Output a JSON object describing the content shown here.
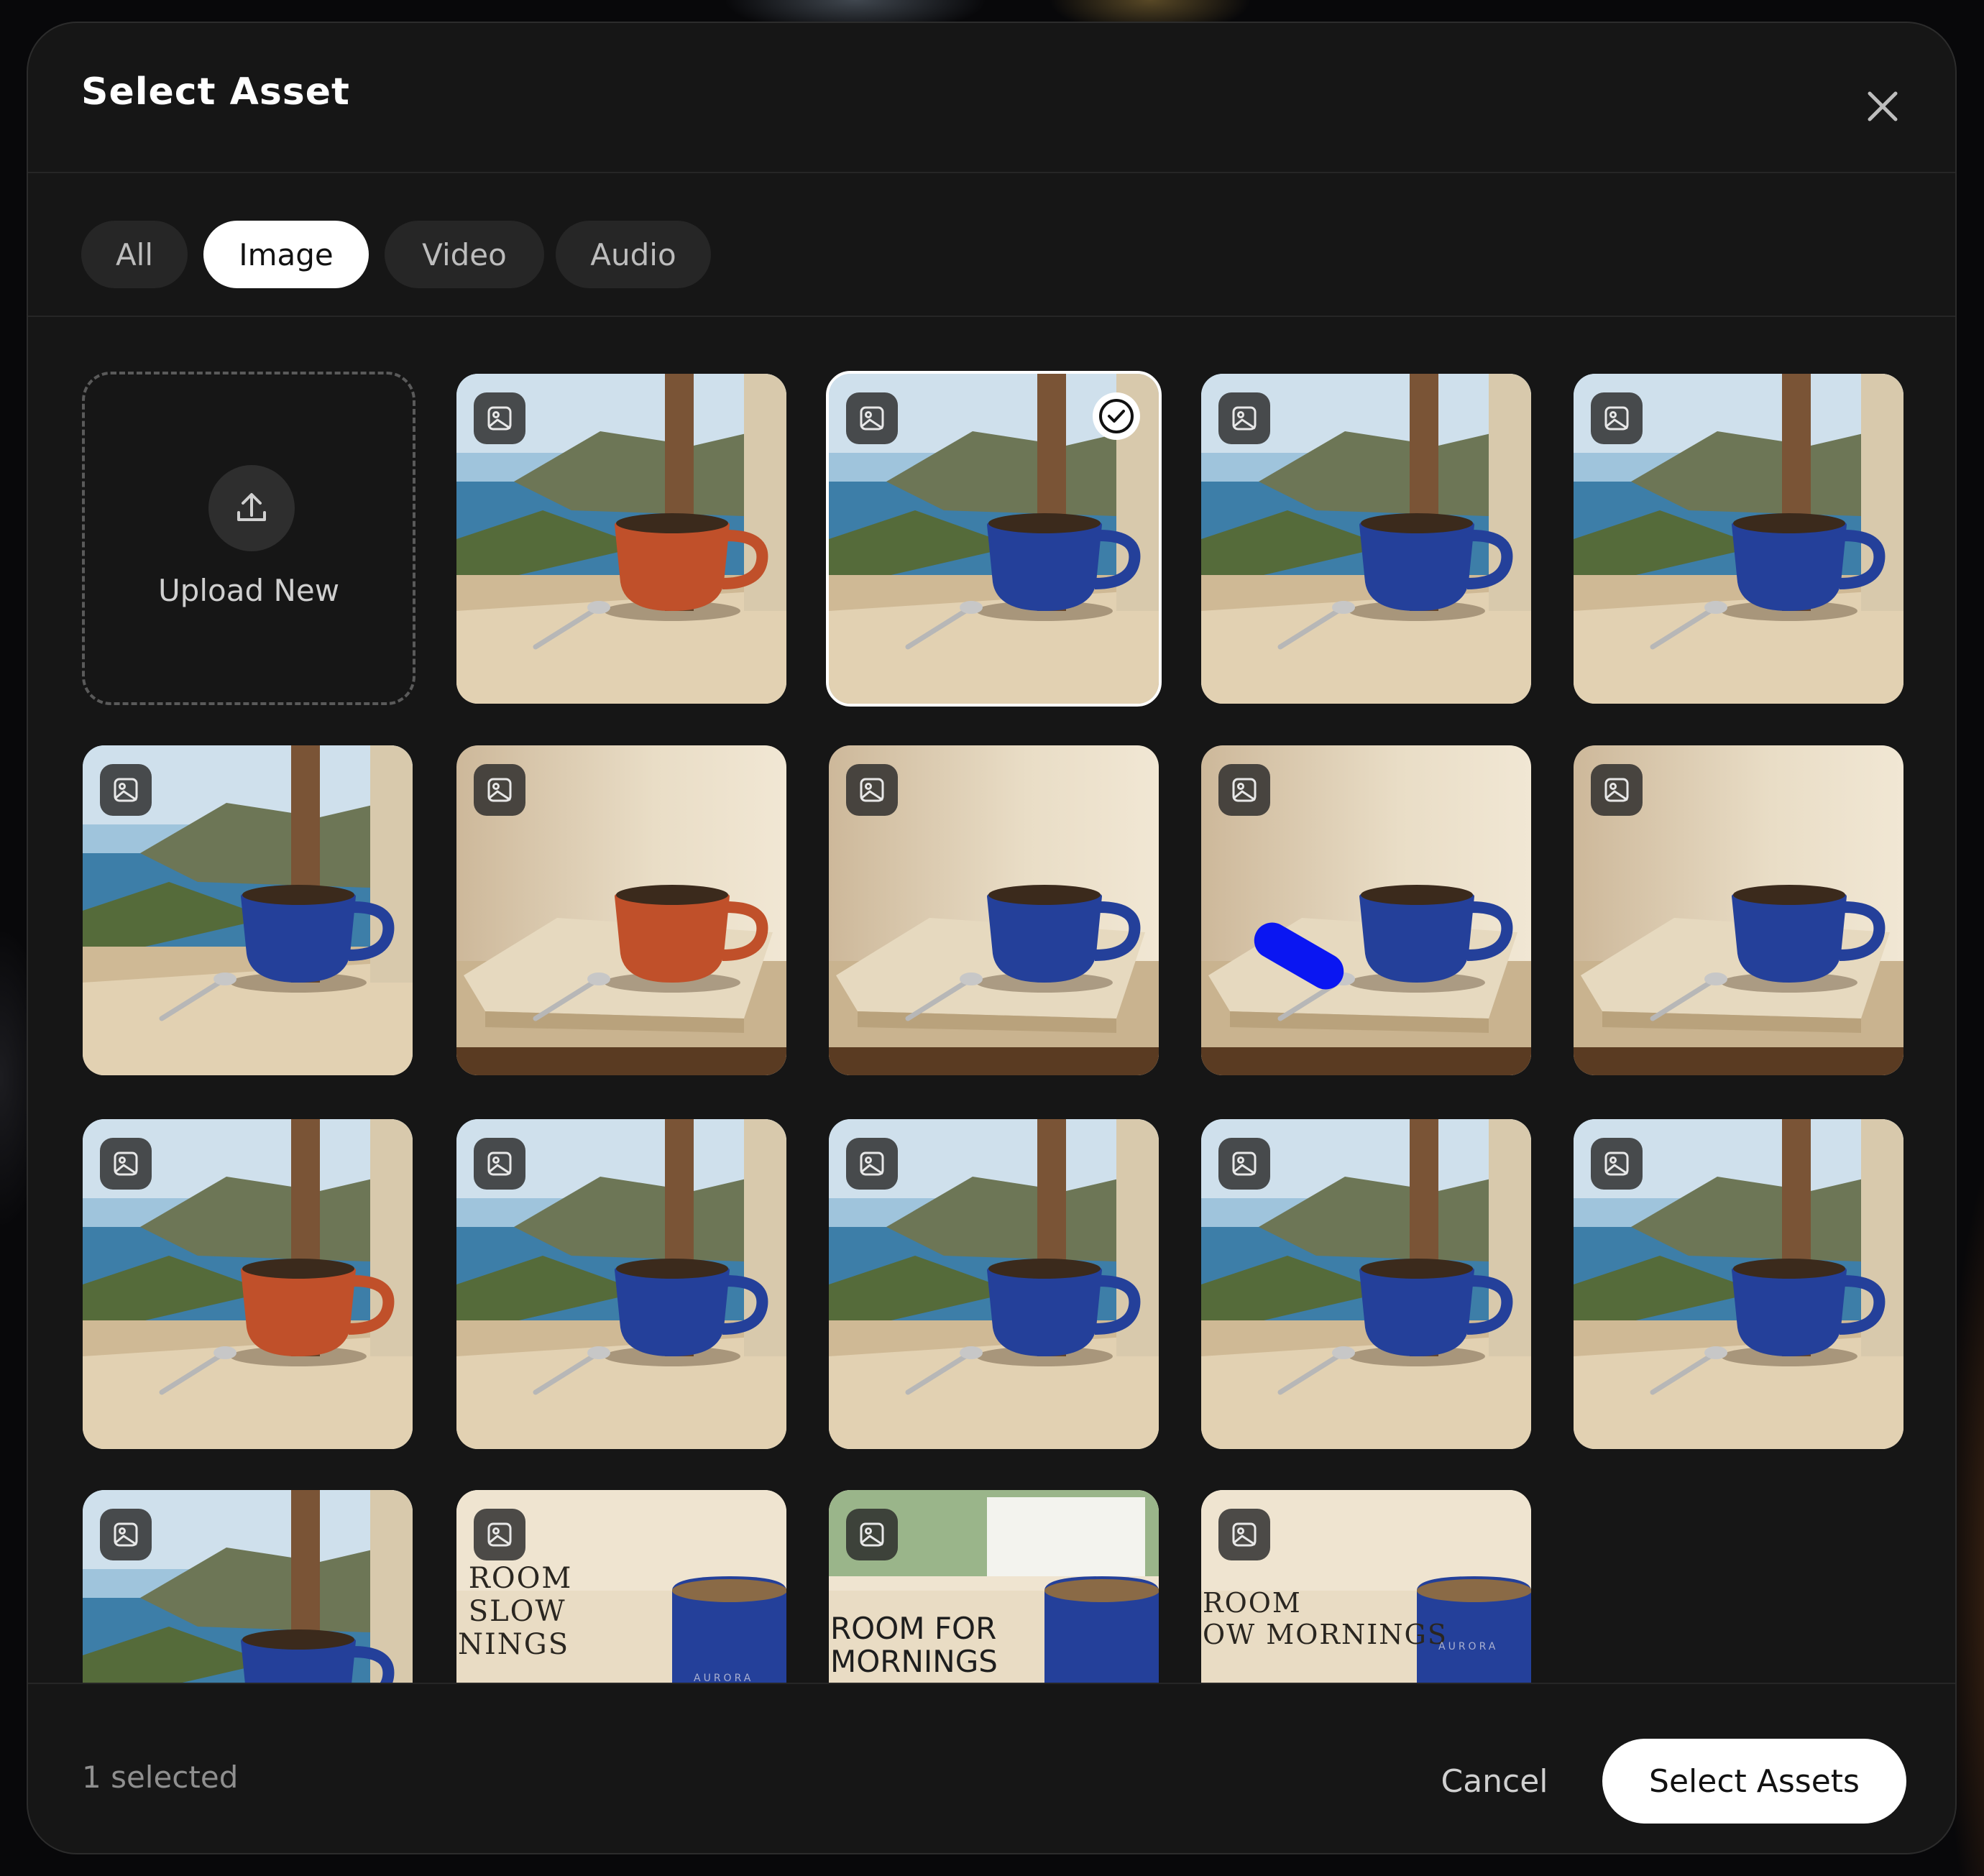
{
  "dialog": {
    "title": "Select Asset",
    "close_icon": "close-icon"
  },
  "tabs": [
    {
      "label": "All",
      "active": false
    },
    {
      "label": "Image",
      "active": true
    },
    {
      "label": "Video",
      "active": false
    },
    {
      "label": "Audio",
      "active": false
    }
  ],
  "upload": {
    "label": "Upload New",
    "icon": "upload-icon"
  },
  "assets": [
    {
      "type_icon": "image-icon",
      "cup": "terracotta",
      "scene": "window-coast-pot",
      "selected": false
    },
    {
      "type_icon": "image-icon",
      "cup": "cobalt-blue",
      "scene": "window-coast-pot",
      "selected": true
    },
    {
      "type_icon": "image-icon",
      "cup": "cobalt-blue",
      "scene": "window-bay-olive",
      "selected": false
    },
    {
      "type_icon": "image-icon",
      "cup": "cobalt-blue",
      "scene": "window-bay-sill",
      "selected": false
    },
    {
      "type_icon": "image-icon",
      "cup": "cobalt-blue",
      "scene": "window-sea-sill",
      "selected": false
    },
    {
      "type_icon": "image-icon",
      "cup": "terracotta",
      "scene": "plaster-wall-stone",
      "selected": false
    },
    {
      "type_icon": "image-icon",
      "cup": "cobalt-blue",
      "scene": "plaster-wall-stone",
      "selected": false
    },
    {
      "type_icon": "image-icon",
      "cup": "cobalt-blue",
      "scene": "plaster-wall-stone-marked",
      "selected": false
    },
    {
      "type_icon": "image-icon",
      "cup": "cobalt-blue",
      "scene": "plaster-wall-stone",
      "selected": false
    },
    {
      "type_icon": "image-icon",
      "cup": "terracotta",
      "scene": "window-island-sill",
      "selected": false
    },
    {
      "type_icon": "image-icon",
      "cup": "cobalt-blue",
      "scene": "window-village-olive",
      "selected": false
    },
    {
      "type_icon": "image-icon",
      "cup": "cobalt-blue",
      "scene": "window-cliff-sill",
      "selected": false
    },
    {
      "type_icon": "image-icon",
      "cup": "cobalt-blue",
      "scene": "window-cove-village",
      "selected": false
    },
    {
      "type_icon": "image-icon",
      "cup": "cobalt-blue",
      "scene": "window-island-sill",
      "selected": false
    },
    {
      "type_icon": "image-icon",
      "cup": "cobalt-blue",
      "scene": "window-coast-partial",
      "selected": false
    },
    {
      "type_icon": "image-icon",
      "cup": "cobalt-blue",
      "scene": "ad-text-serif",
      "overlay_text": " ROOM\n SLOW\nNINGS",
      "brand": "AURORA",
      "selected": false
    },
    {
      "type_icon": "image-icon",
      "cup": "cobalt-blue",
      "scene": "ad-text-sans",
      "overlay_text": "ROOM FOR\nMORNINGS",
      "selected": false
    },
    {
      "type_icon": "image-icon",
      "cup": "cobalt-blue",
      "scene": "ad-text-serif",
      "overlay_text": "ROOM\nOW MORNINGS",
      "brand": "AURORA",
      "selected": false
    }
  ],
  "footer": {
    "selected_count": "1 selected",
    "cancel_label": "Cancel",
    "confirm_label": "Select Assets"
  },
  "colors": {
    "modal_bg": "#161616",
    "accent": "#ffffff",
    "cobalt_cup": "#24409a",
    "terracotta_cup": "#c0502a",
    "marker_stroke": "#0a16f2"
  }
}
